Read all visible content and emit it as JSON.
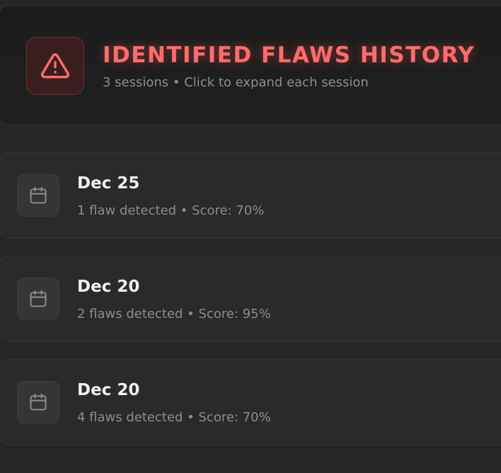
{
  "header": {
    "title": "IDENTIFIED FLAWS HISTORY",
    "subtitle": "3 sessions • Click to expand each session",
    "icon": "warning-triangle-icon",
    "accent_color": "#ff6b6b"
  },
  "sessions": [
    {
      "date": "Dec 25",
      "summary": "1 flaw detected • Score: 70%",
      "icon": "calendar-icon"
    },
    {
      "date": "Dec 20",
      "summary": "2 flaws detected • Score: 95%",
      "icon": "calendar-icon"
    },
    {
      "date": "Dec 20",
      "summary": "4 flaws detected • Score: 70%",
      "icon": "calendar-icon"
    }
  ]
}
